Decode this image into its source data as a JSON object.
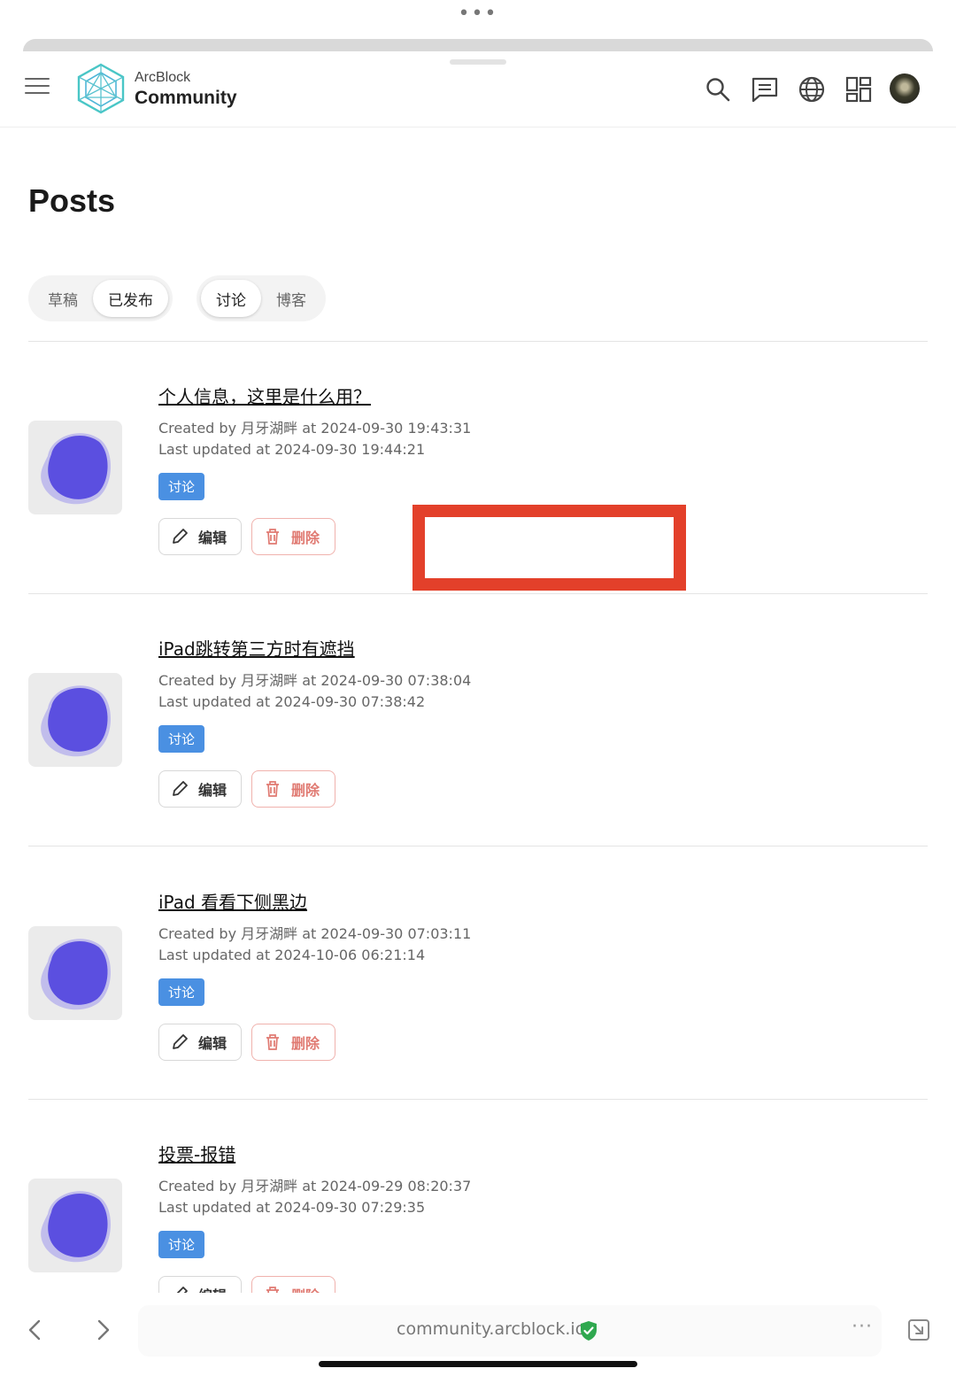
{
  "header": {
    "brand_top": "ArcBlock",
    "brand_main": "Community"
  },
  "page": {
    "title": "Posts"
  },
  "filters": {
    "status": [
      {
        "label": "草稿",
        "active": false
      },
      {
        "label": "已发布",
        "active": true
      }
    ],
    "kind": [
      {
        "label": "讨论",
        "active": true
      },
      {
        "label": "博客",
        "active": false
      }
    ]
  },
  "posts": [
    {
      "title": "个人信息，这里是什么用？",
      "created": "Created by 月牙湖畔 at 2024-09-30 19:43:31",
      "updated": "Last updated at 2024-09-30 19:44:21",
      "tag": "讨论",
      "edit_label": "编辑",
      "delete_label": "删除"
    },
    {
      "title": "iPad跳转第三方时有遮挡",
      "created": "Created by 月牙湖畔 at 2024-09-30 07:38:04",
      "updated": "Last updated at 2024-09-30 07:38:42",
      "tag": "讨论",
      "edit_label": "编辑",
      "delete_label": "删除"
    },
    {
      "title": "iPad 看看下侧黑边",
      "created": "Created by 月牙湖畔 at 2024-09-30 07:03:11",
      "updated": "Last updated at 2024-10-06 06:21:14",
      "tag": "讨论",
      "edit_label": "编辑",
      "delete_label": "删除"
    },
    {
      "title": "投票-报错",
      "created": "Created by 月牙湖畔 at 2024-09-29 08:20:37",
      "updated": "Last updated at 2024-09-30 07:29:35",
      "tag": "讨论",
      "edit_label": "编辑",
      "delete_label": "删除"
    }
  ],
  "browser": {
    "url": "community.arcblock.io",
    "more": "···"
  },
  "colors": {
    "tag_bg": "#4a90e2",
    "delete": "#e07a72",
    "annotation": "#e3402a",
    "thumb_blob": "#5b4fe0"
  },
  "icons": [
    "menu-icon",
    "arcblock-logo",
    "search-icon",
    "chat-icon",
    "globe-icon",
    "apps-grid-icon",
    "pencil-icon",
    "trash-icon",
    "back-arrow-icon",
    "forward-arrow-icon",
    "shield-check-icon",
    "resize-icon"
  ]
}
